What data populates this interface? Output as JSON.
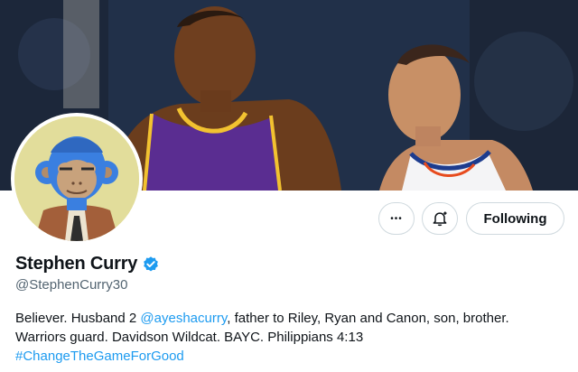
{
  "profile": {
    "name": "Stephen Curry",
    "handle": "@StephenCurry30",
    "bio": {
      "line1_a": "Believer. Husband 2 ",
      "mention": "@ayeshacurry",
      "line1_b": ", father to Riley, Ryan and Canon, son, brother.",
      "line2": "Warriors guard. Davidson Wildcat. BAYC. Philippians 4:13",
      "hashtag": "#ChangeTheGameForGood"
    }
  },
  "actions": {
    "more_label": "•••",
    "follow_label": "Following"
  },
  "colors": {
    "accent": "#1d9bf0",
    "text_primary": "#0f1419",
    "text_secondary": "#536471",
    "avatar_bg": "#e2dd9b"
  },
  "icons": {
    "more": "more-horizontal-icon",
    "notify": "bell-plus-icon",
    "verified": "verified-badge-icon"
  }
}
